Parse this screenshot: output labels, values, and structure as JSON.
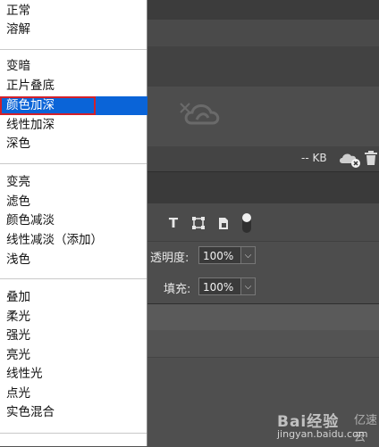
{
  "blend_menu": {
    "group1": [
      "正常",
      "溶解"
    ],
    "group2": [
      "变暗",
      "正片叠底",
      "颜色加深",
      "线性加深",
      "深色"
    ],
    "group3": [
      "变亮",
      "滤色",
      "颜色减淡",
      "线性减淡（添加）",
      "浅色"
    ],
    "group4": [
      "叠加",
      "柔光",
      "强光",
      "亮光",
      "线性光",
      "点光",
      "实色混合"
    ],
    "selected": "颜色加深"
  },
  "library": {
    "size_text": "-- KB"
  },
  "layers": {
    "opacity_label": "透明度:",
    "opacity_value": "100%",
    "fill_label": "填充:",
    "fill_value": "100%"
  },
  "watermark": {
    "main": "Bai经验",
    "sub": "jingyan.baidu.com",
    "right": "亿速云"
  },
  "icons": {
    "grid_view": "grid-view-icon",
    "list_view": "list-view-icon",
    "creative_cloud": "creative-cloud-offline-icon",
    "cloud_status": "cloud-offline-icon",
    "trash": "trash-icon",
    "type_filter": "type-layer-filter-icon",
    "shape_filter": "shape-layer-filter-icon",
    "smart_filter": "smart-object-filter-icon",
    "filter_toggle": "filter-toggle-icon",
    "dropdown_arrow": "chevron-down-icon"
  },
  "colors": {
    "selection": "#0a64d8",
    "highlight_outline": "#d2202a",
    "panel_bg": "#535353"
  }
}
